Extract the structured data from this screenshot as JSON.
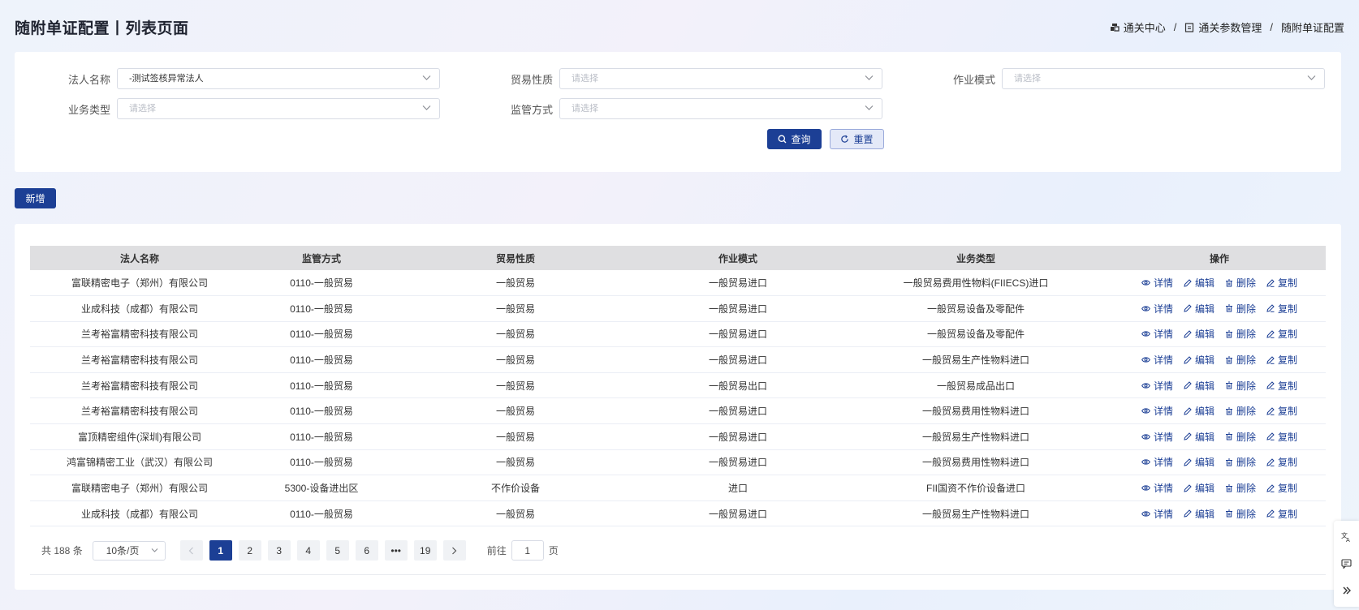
{
  "page": {
    "title": "随附单证配置丨列表页面",
    "breadcrumb": [
      "通关中心",
      "通关参数管理",
      "随附单证配置"
    ]
  },
  "filters": {
    "legal_name": {
      "label": "法人名称",
      "value": "-测试签核异常法人"
    },
    "trade_nature": {
      "label": "贸易性质",
      "placeholder": "请选择"
    },
    "work_mode": {
      "label": "作业模式",
      "placeholder": "请选择"
    },
    "business_type": {
      "label": "业务类型",
      "placeholder": "请选择"
    },
    "supervision": {
      "label": "监管方式",
      "placeholder": "请选择"
    },
    "query_label": "查询",
    "reset_label": "重置"
  },
  "toolbar": {
    "add_label": "新增"
  },
  "table": {
    "headers": [
      "法人名称",
      "监管方式",
      "贸易性质",
      "作业模式",
      "业务类型",
      "操作"
    ],
    "rows": [
      [
        "富联精密电子（郑州）有限公司",
        "0110-一般贸易",
        "一般贸易",
        "一般贸易进口",
        "一般贸易费用性物料(FIIECS)进口"
      ],
      [
        "业成科技（成都）有限公司",
        "0110-一般贸易",
        "一般贸易",
        "一般贸易进口",
        "一般贸易设备及零配件"
      ],
      [
        "兰考裕富精密科技有限公司",
        "0110-一般贸易",
        "一般贸易",
        "一般贸易进口",
        "一般贸易设备及零配件"
      ],
      [
        "兰考裕富精密科技有限公司",
        "0110-一般贸易",
        "一般贸易",
        "一般贸易进口",
        "一般贸易生产性物料进口"
      ],
      [
        "兰考裕富精密科技有限公司",
        "0110-一般贸易",
        "一般贸易",
        "一般贸易出口",
        "一般贸易成品出口"
      ],
      [
        "兰考裕富精密科技有限公司",
        "0110-一般贸易",
        "一般贸易",
        "一般贸易进口",
        "一般贸易费用性物料进口"
      ],
      [
        "富顶精密组件(深圳)有限公司",
        "0110-一般贸易",
        "一般贸易",
        "一般贸易进口",
        "一般贸易生产性物料进口"
      ],
      [
        "鸿富锦精密工业（武汉）有限公司",
        "0110-一般贸易",
        "一般贸易",
        "一般贸易进口",
        "一般贸易费用性物料进口"
      ],
      [
        "富联精密电子（郑州）有限公司",
        "5300-设备进出区",
        "不作价设备",
        "进口",
        "FII国资不作价设备进口"
      ],
      [
        "业成科技（成都）有限公司",
        "0110-一般贸易",
        "一般贸易",
        "一般贸易进口",
        "一般贸易生产性物料进口"
      ]
    ],
    "actions": [
      "详情",
      "编辑",
      "删除",
      "复制"
    ]
  },
  "pagination": {
    "total": "共 188 条",
    "page_size": "10条/页",
    "pages": [
      "1",
      "2",
      "3",
      "4",
      "5",
      "6",
      "•••",
      "19"
    ],
    "current": "1",
    "goto_prefix": "前往",
    "goto_value": "1",
    "goto_suffix": "页"
  },
  "side_tools": [
    "translate-icon",
    "message-icon",
    "collapse-icon"
  ],
  "colors": {
    "primary": "#1c3f95",
    "header_bg": "#dfdfe1"
  }
}
